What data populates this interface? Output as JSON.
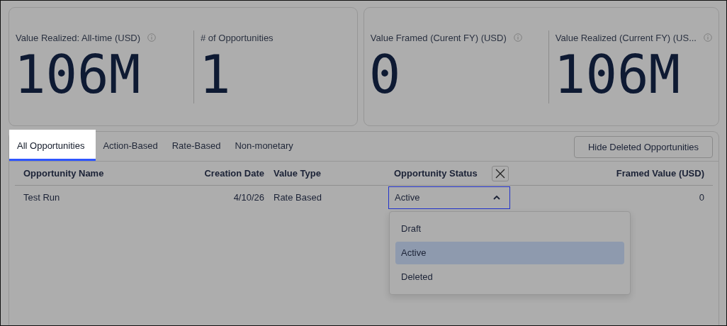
{
  "metric_cards": [
    {
      "tiles": [
        {
          "label": "Value Realized: All-time (USD)",
          "value": "106M",
          "info_icon": true
        },
        {
          "label": "# of Opportunities",
          "value": "1",
          "info_icon": false
        }
      ]
    },
    {
      "tiles": [
        {
          "label": "Value Framed (Curent FY) (USD)",
          "value": "0",
          "info_icon": true
        },
        {
          "label": "Value Realized (Current FY) (US...",
          "value": "106M",
          "info_icon": true
        }
      ]
    }
  ],
  "tabs": [
    {
      "label": "All Opportunities",
      "selected": true
    },
    {
      "label": "Action-Based",
      "selected": false
    },
    {
      "label": "Rate-Based",
      "selected": false
    },
    {
      "label": "Non-monetary",
      "selected": false
    }
  ],
  "hide_deleted_button": "Hide Deleted Opportunities",
  "table": {
    "columns": [
      {
        "label": "Opportunity Name"
      },
      {
        "label": "Creation Date"
      },
      {
        "label": "Value Type"
      },
      {
        "label": "Opportunity Status",
        "clear_button": true
      },
      {
        "label": "Framed Value (USD)"
      }
    ],
    "rows": [
      {
        "cells": [
          {
            "kind": "text",
            "text": "Test Run"
          },
          {
            "kind": "text",
            "text": "4/10/26"
          },
          {
            "kind": "text",
            "text": "Rate Based"
          },
          {
            "kind": "select",
            "value": "Active",
            "expanded": true,
            "options": [
              {
                "label": "Draft",
                "selected": false
              },
              {
                "label": "Active",
                "selected": true
              },
              {
                "label": "Deleted",
                "selected": false
              }
            ]
          },
          {
            "kind": "text",
            "text": "0"
          }
        ]
      }
    ]
  }
}
